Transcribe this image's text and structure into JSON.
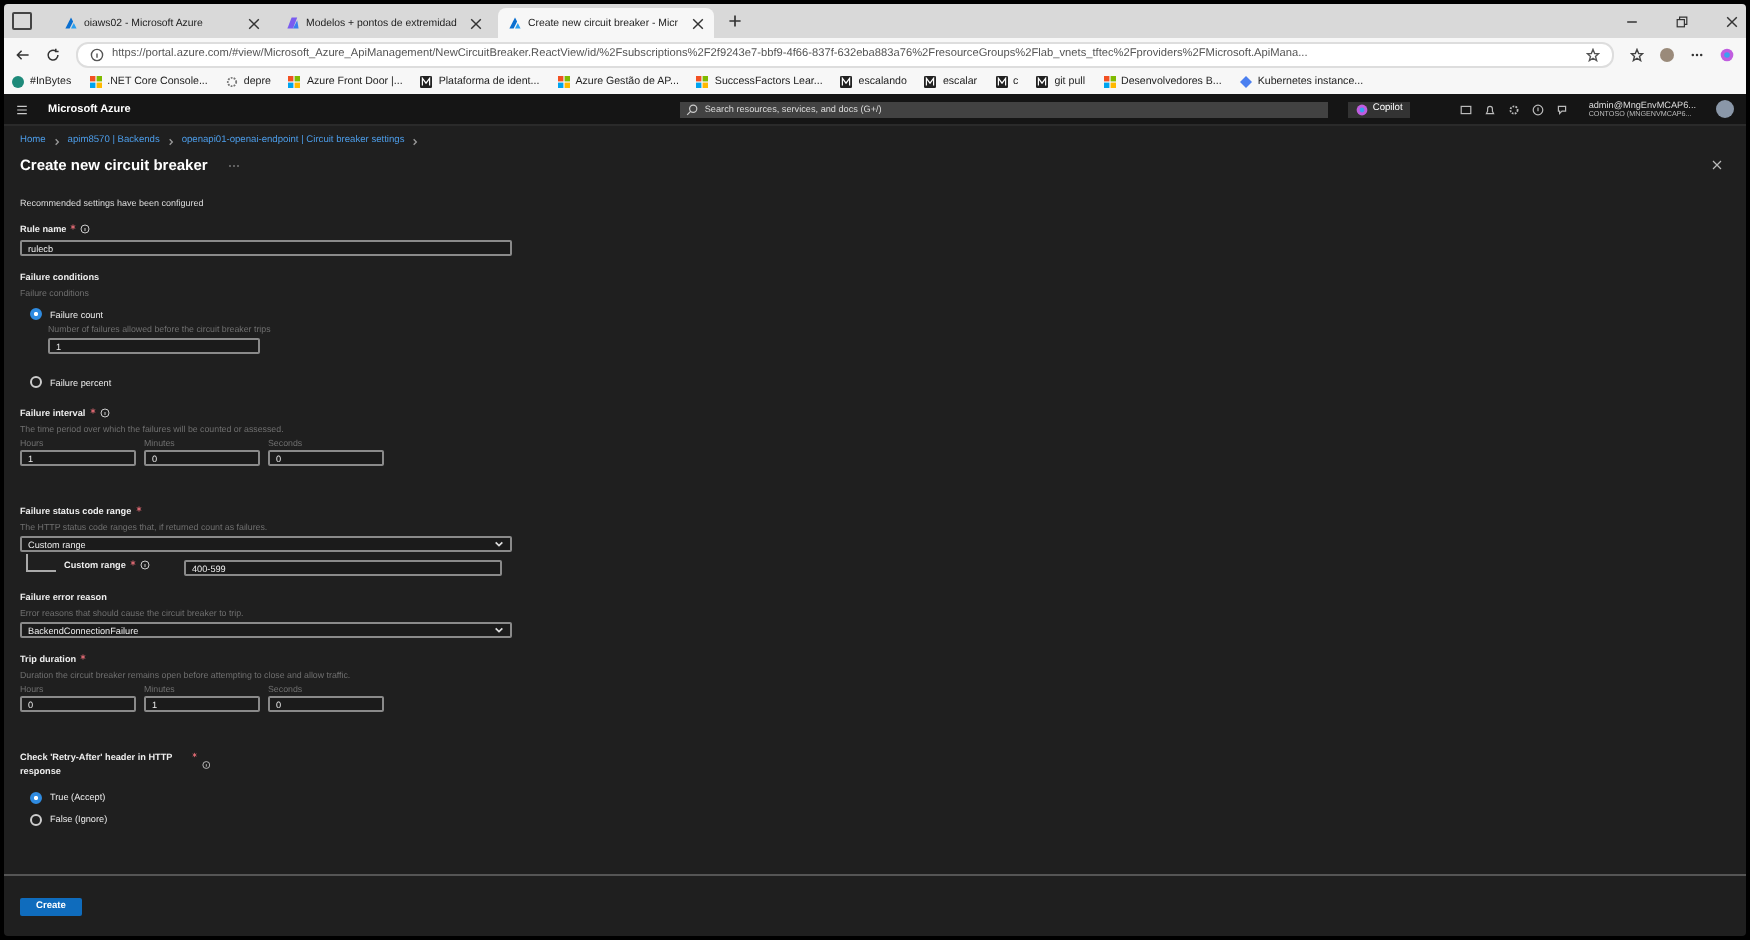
{
  "browser": {
    "tabs": [
      {
        "title": "oiaws02 - Microsoft Azure",
        "selected": false
      },
      {
        "title": "Modelos + pontos de extremidad",
        "selected": false
      },
      {
        "title": "Create new circuit breaker - Micr",
        "selected": true
      }
    ],
    "url": "https://portal.azure.com/#view/Microsoft_Azure_ApiManagement/NewCircuitBreaker.ReactView/id/%2Fsubscriptions%2F2f9243e7-bbf9-4f66-837f-632eba883a76%2FresourceGroups%2Flab_vnets_tftec%2Fproviders%2FMicrosoft.ApiMana...",
    "bookmarks": [
      {
        "label": "#InBytes",
        "kind": "round"
      },
      {
        "label": ".NET Core Console...",
        "kind": "tiles"
      },
      {
        "label": "depre",
        "kind": "gear"
      },
      {
        "label": "Azure Front Door |...",
        "kind": "tiles"
      },
      {
        "label": "Plataforma de ident...",
        "kind": "letter"
      },
      {
        "label": "Azure Gestão de AP...",
        "kind": "tiles"
      },
      {
        "label": "SuccessFactors Lear...",
        "kind": "tiles"
      },
      {
        "label": "escalando",
        "kind": "letter"
      },
      {
        "label": "escalar",
        "kind": "letter"
      },
      {
        "label": "c",
        "kind": "letter"
      },
      {
        "label": "git pull",
        "kind": "letter"
      },
      {
        "label": "Desenvolvedores B...",
        "kind": "tiles"
      },
      {
        "label": "Kubernetes instance...",
        "kind": "diamond"
      }
    ]
  },
  "portal": {
    "brand": "Microsoft Azure",
    "search": {
      "placeholder": "Search resources, services, and docs (G+/)"
    },
    "copilot": "Copilot",
    "account": {
      "user": "admin@MngEnvMCAP6...",
      "directory": "CONTOSO (MNGENVMCAP6..."
    }
  },
  "breadcrumb": [
    "Home",
    "apim8570 | Backends",
    "openapi01-openai-endpoint | Circuit breaker settings"
  ],
  "title": "Create new circuit breaker",
  "notice": "Recommended settings have been configured",
  "fields": [
    {
      "kind": "text",
      "label": "Rule name",
      "required": true,
      "info": true,
      "value": "rulecb"
    },
    {
      "kind": "radios",
      "label": "Failure conditions",
      "required": false,
      "info": false,
      "description": "Failure conditions",
      "options": [
        {
          "label": "Failure count",
          "selected": true,
          "hint": "Number of failures allowed before the circuit breaker trips",
          "value": "1"
        },
        {
          "label": "Failure percent",
          "selected": false
        }
      ]
    },
    {
      "kind": "duration",
      "label": "Failure interval",
      "required": true,
      "info": true,
      "description": "The time period over which the failures will be counted or assessed.",
      "parts": [
        {
          "label": "Hours",
          "value": "1"
        },
        {
          "label": "Minutes",
          "value": "0"
        },
        {
          "label": "Seconds",
          "value": "0"
        }
      ]
    },
    {
      "kind": "select",
      "label": "Failure status code range",
      "required": true,
      "info": false,
      "description": "The HTTP status code ranges that, if returned count as failures.",
      "value": "Custom range",
      "sub": {
        "label": "Custom range",
        "required": true,
        "info": true,
        "value": "400-599"
      }
    },
    {
      "kind": "select",
      "label": "Failure error reason",
      "required": false,
      "info": false,
      "description": "Error reasons that should cause the circuit breaker to trip.",
      "value": "BackendConnectionFailure"
    },
    {
      "kind": "duration",
      "label": "Trip duration",
      "required": true,
      "info": false,
      "description": "Duration the circuit breaker remains open before attempting to close and allow traffic.",
      "parts": [
        {
          "label": "Hours",
          "value": "0"
        },
        {
          "label": "Minutes",
          "value": "1"
        },
        {
          "label": "Seconds",
          "value": "0"
        }
      ]
    },
    {
      "kind": "radios",
      "label": "Check 'Retry-After' header in HTTP response",
      "required": true,
      "info": true,
      "options": [
        {
          "label": "True (Accept)",
          "selected": true
        },
        {
          "label": "False (Ignore)",
          "selected": false
        }
      ]
    }
  ],
  "footer": {
    "button": "Create"
  }
}
